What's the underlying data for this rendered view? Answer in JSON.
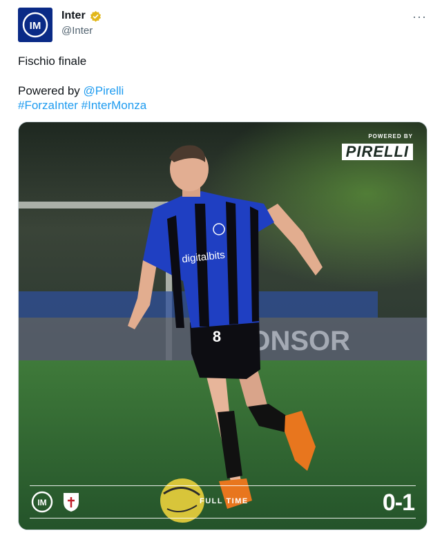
{
  "account": {
    "name": "Inter",
    "handle": "@Inter",
    "verified": true,
    "brand_color": "#0a2a86"
  },
  "menu_icon": "more-horizontal-icon",
  "tweet": {
    "line1": "Fischio finale",
    "powered_prefix": "Powered by ",
    "powered_mention": "@Pirelli",
    "hashtag1": "#ForzaInter",
    "hashtag2": "#InterMonza"
  },
  "media": {
    "sponsor_small": "POWERED BY",
    "sponsor_logo": "IRELLI",
    "jersey_sponsor": "digitalbits",
    "jersey_number": "8",
    "banner_text": "SPONSOR",
    "status": "FULL TIME",
    "score": "0-1",
    "home_team_icon": "inter-crest-icon",
    "away_team_icon": "monza-crest-icon",
    "link_color": "#1d9bf0"
  }
}
